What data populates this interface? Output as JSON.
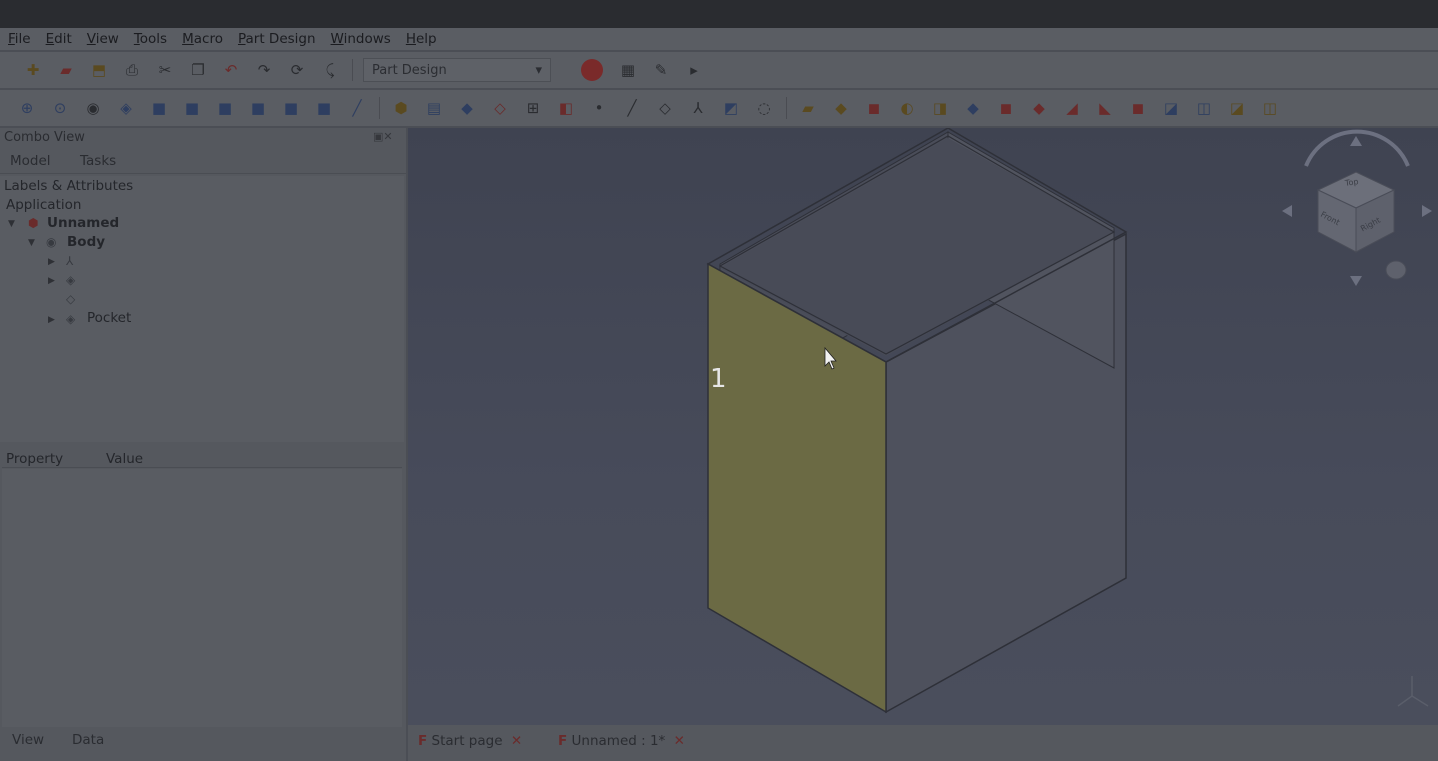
{
  "menu": [
    "File",
    "Edit",
    "View",
    "Tools",
    "Macro",
    "Part Design",
    "Windows",
    "Help"
  ],
  "toolbar": {
    "workbench": "Part Design"
  },
  "combo_view": {
    "title": "Combo View",
    "tabs": [
      "Model",
      "Tasks"
    ],
    "labels_header": "Labels & Attributes",
    "application": "Application",
    "tree": {
      "document": "Unnamed",
      "body": "Body",
      "feature": "Pocket"
    },
    "property_header": "Property",
    "value_header": "Value",
    "bottom_tabs": [
      "View",
      "Data"
    ]
  },
  "viewport": {
    "face_label": "1",
    "navcube": {
      "top": "Top",
      "front": "Front",
      "right": "Right"
    }
  },
  "document_tabs": [
    "Start page",
    "Unnamed : 1*"
  ]
}
